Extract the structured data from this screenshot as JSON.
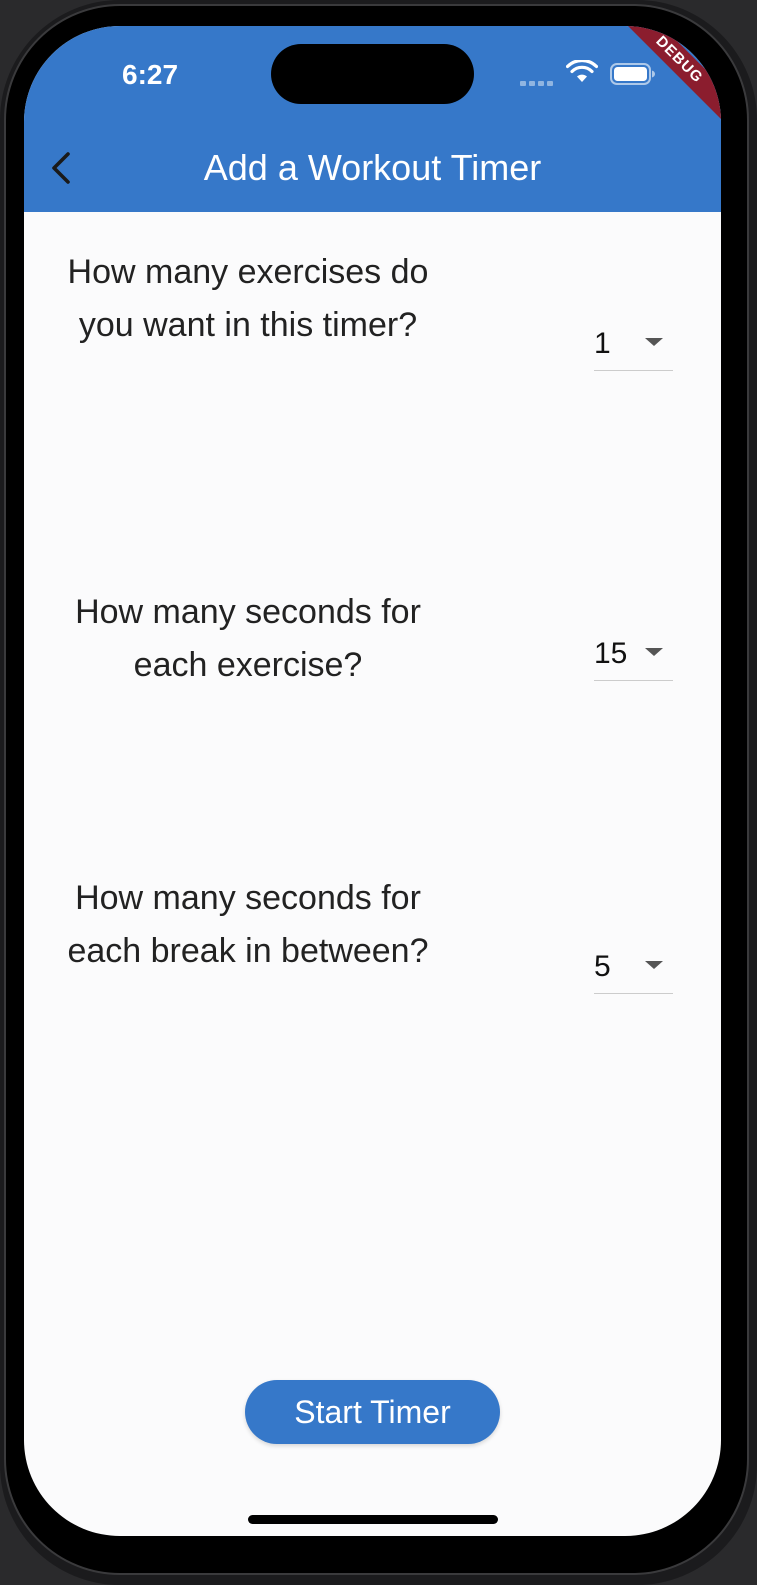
{
  "status_bar": {
    "time": "6:27",
    "signal_icon": "cellular-signal-icon",
    "wifi_icon": "wifi-icon",
    "battery_icon": "battery-icon"
  },
  "debug_banner": "DEBUG",
  "app_bar": {
    "back_icon": "chevron-left-icon",
    "title": "Add a Workout Timer",
    "color": "#3678c9"
  },
  "form": {
    "exercises": {
      "question": "How many exercises do you want in this timer?",
      "value": "1"
    },
    "exercise_seconds": {
      "question": "How many seconds for each exercise?",
      "value": "15"
    },
    "break_seconds": {
      "question": "How many seconds for each break in between?",
      "value": "5"
    }
  },
  "start_button": "Start Timer"
}
